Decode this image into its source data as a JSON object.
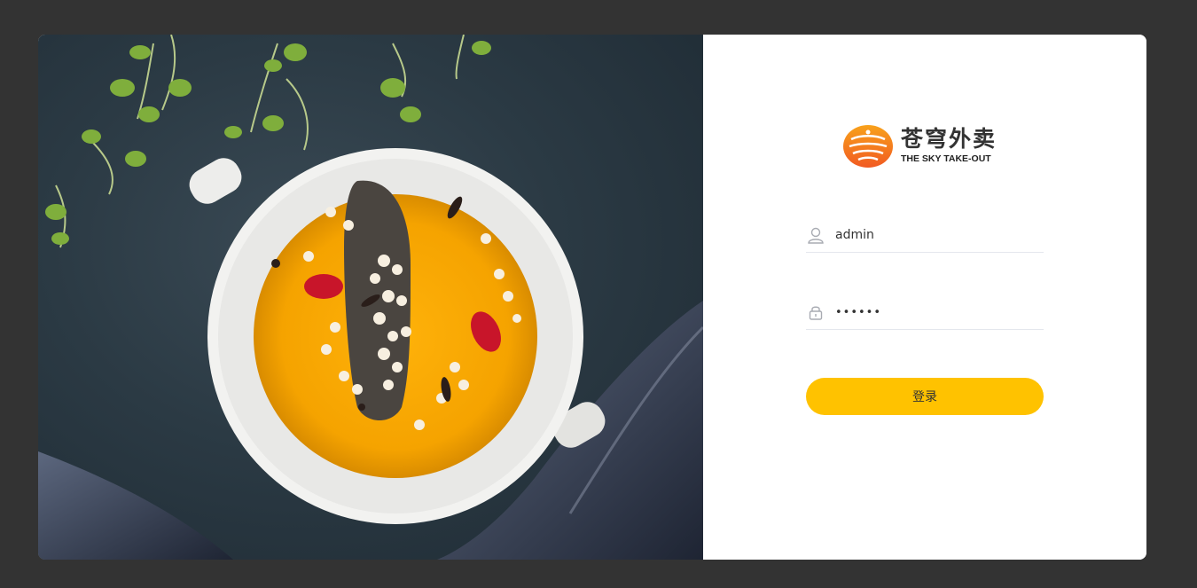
{
  "brand": {
    "name_cn": "苍穹外卖",
    "name_en": "THE SKY TAKE-OUT"
  },
  "login_form": {
    "username": {
      "value": "admin",
      "icon": "user-icon"
    },
    "password": {
      "value": "••••••",
      "icon": "lock-icon"
    },
    "submit_label": "登录"
  },
  "colors": {
    "page_background": "#333333",
    "accent": "#ffc200",
    "logo_orange": "#f47a20",
    "card_background": "#ffffff"
  }
}
